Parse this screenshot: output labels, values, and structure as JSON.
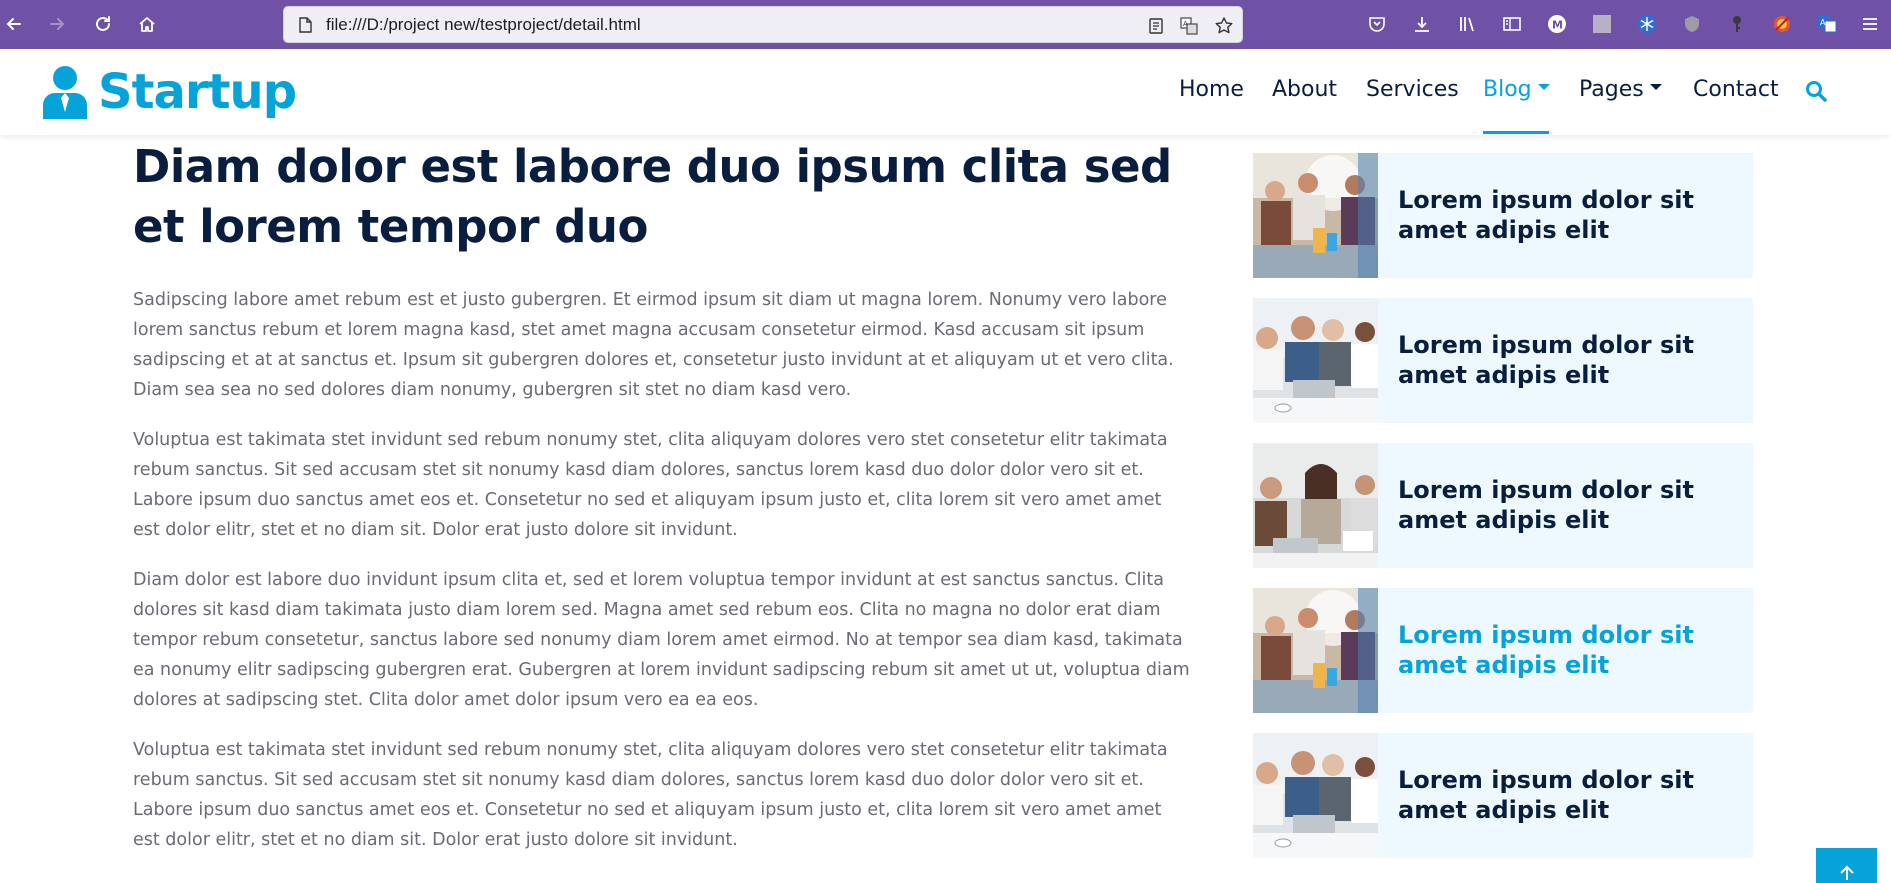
{
  "browser": {
    "url": "file:///D:/project new/testproject/detail.html",
    "chrome_color": "#6f52a5"
  },
  "site": {
    "brand": "Startup",
    "accent": "#06a3da",
    "nav": {
      "home": "Home",
      "about": "About",
      "services": "Services",
      "blog": "Blog",
      "pages": "Pages",
      "contact": "Contact"
    }
  },
  "article": {
    "title": "Diam dolor est labore duo ipsum clita sed et lorem tempor duo",
    "paragraphs": [
      "Sadipscing labore amet rebum est et justo gubergren. Et eirmod ipsum sit diam ut magna lorem. Nonumy vero labore lorem sanctus rebum et lorem magna kasd, stet amet magna accusam consetetur eirmod. Kasd accusam sit ipsum sadipscing et at at sanctus et. Ipsum sit gubergren dolores et, consetetur justo invidunt at et aliquyam ut et vero clita. Diam sea sea no sed dolores diam nonumy, gubergren sit stet no diam kasd vero.",
      "Voluptua est takimata stet invidunt sed rebum nonumy stet, clita aliquyam dolores vero stet consetetur elitr takimata rebum sanctus. Sit sed accusam stet sit nonumy kasd diam dolores, sanctus lorem kasd duo dolor dolor vero sit et. Labore ipsum duo sanctus amet eos et. Consetetur no sed et aliquyam ipsum justo et, clita lorem sit vero amet amet est dolor elitr, stet et no diam sit. Dolor erat justo dolore sit invidunt.",
      "Diam dolor est labore duo invidunt ipsum clita et, sed et lorem voluptua tempor invidunt at est sanctus sanctus. Clita dolores sit kasd diam takimata justo diam lorem sed. Magna amet sed rebum eos. Clita no magna no dolor erat diam tempor rebum consetetur, sanctus labore sed nonumy diam lorem amet eirmod. No at tempor sea diam kasd, takimata ea nonumy elitr sadipscing gubergren erat. Gubergren at lorem invidunt sadipscing rebum sit amet ut ut, voluptua diam dolores at sadipscing stet. Clita dolor amet dolor ipsum vero ea ea eos.",
      "Voluptua est takimata stet invidunt sed rebum nonumy stet, clita aliquyam dolores vero stet consetetur elitr takimata rebum sanctus. Sit sed accusam stet sit nonumy kasd diam dolores, sanctus lorem kasd duo dolor dolor vero sit et. Labore ipsum duo sanctus amet eos et. Consetetur no sed et aliquyam ipsum justo et, clita lorem sit vero amet amet est dolor elitr, stet et no diam sit. Dolor erat justo dolore sit invidunt."
    ]
  },
  "recent_posts": [
    {
      "title": "Lorem ipsum dolor sit amet adipis elit",
      "image": "team-standing-image"
    },
    {
      "title": "Lorem ipsum dolor sit amet adipis elit",
      "image": "meeting-laptop-image"
    },
    {
      "title": "Lorem ipsum dolor sit amet adipis elit",
      "image": "office-woman-image"
    },
    {
      "title": "Lorem ipsum dolor sit amet adipis elit",
      "image": "team-standing-image"
    },
    {
      "title": "Lorem ipsum dolor sit amet adipis elit",
      "image": "meeting-laptop-image"
    }
  ]
}
